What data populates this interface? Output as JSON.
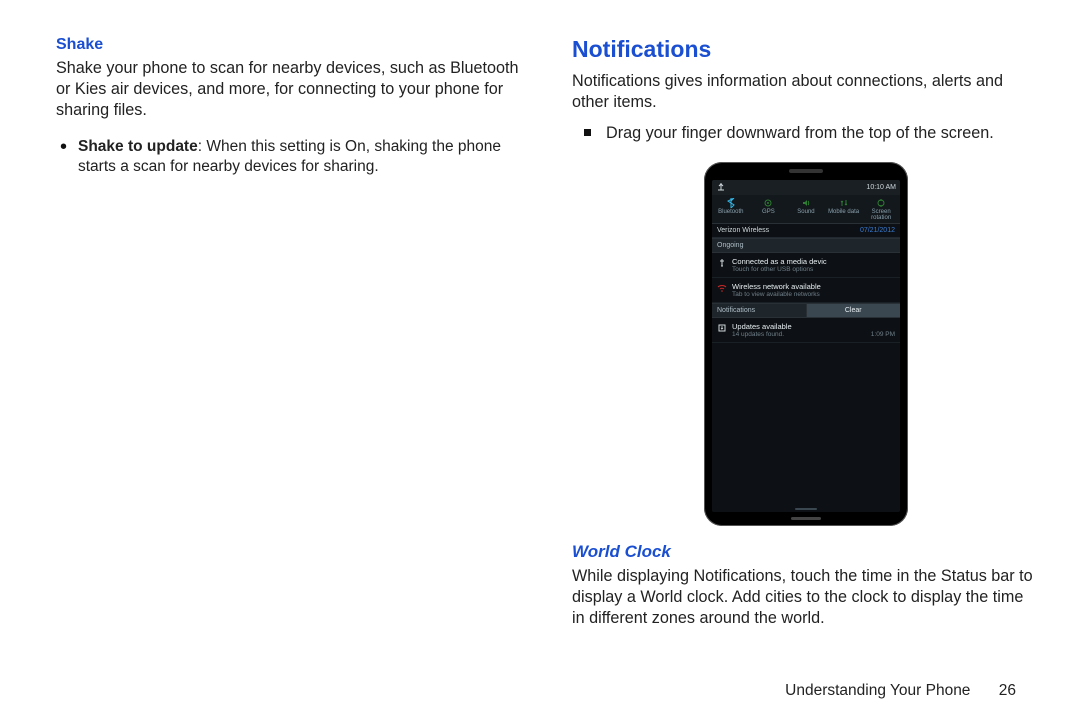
{
  "left": {
    "shake_h": "Shake",
    "shake_p": "Shake your phone to scan for nearby devices, such as Bluetooth or Kies air devices, and more, for connecting to your phone for sharing files.",
    "bullet_b": "Shake to update",
    "bullet_rest": ": When this setting is On, shaking the phone starts a scan for nearby devices for sharing."
  },
  "right": {
    "notif_h": "Notifications",
    "notif_p": "Notifications gives information about connections, alerts and other items.",
    "drag": "Drag your finger downward from the top of the screen.",
    "wc_h": "World Clock",
    "wc_p": "While displaying Notifications, touch the time in the Status bar to display a World clock. Add cities to the clock to display the time in different zones around the world."
  },
  "phone": {
    "time": "10:10 AM",
    "toggles": [
      "Bluetooth",
      "GPS",
      "Sound",
      "Mobile data",
      "Screen rotation"
    ],
    "carrier": "Verizon Wireless",
    "date": "07/21/2012",
    "ongoing": "Ongoing",
    "n1_t": "Connected as a media devic",
    "n1_s": "Touch for other USB options",
    "n2_t": "Wireless network available",
    "n2_s": "Tab to view available networks",
    "hdr_notif": "Notifications",
    "hdr_clear": "Clear",
    "n3_t": "Updates available",
    "n3_s": "14 updates found.",
    "n3_time": "1:09 PM"
  },
  "footer": {
    "section": "Understanding Your Phone",
    "page": "26"
  }
}
